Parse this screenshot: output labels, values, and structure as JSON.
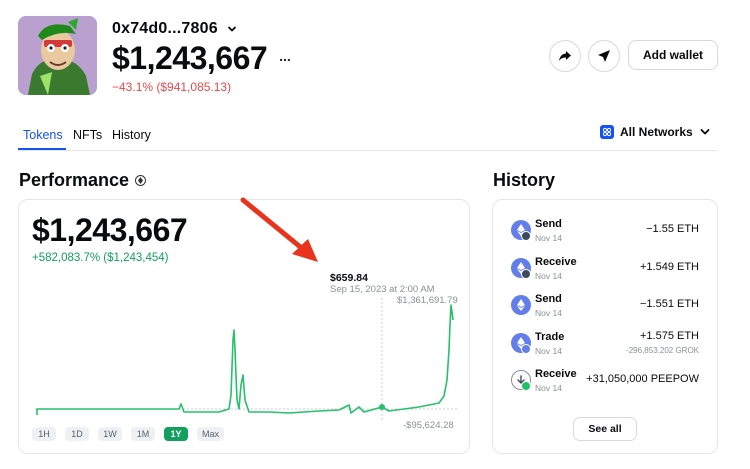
{
  "header": {
    "address": "0x74d0...7806",
    "balance": "$1,243,667",
    "more_label": "...",
    "change": "−43.1% ($941,085.13)",
    "add_wallet_label": "Add wallet"
  },
  "tabs": [
    {
      "label": "Tokens",
      "active": true
    },
    {
      "label": "NFTs",
      "active": false
    },
    {
      "label": "History",
      "active": false
    }
  ],
  "networks_label": "All Networks",
  "performance": {
    "title": "Performance",
    "value": "$1,243,667",
    "gain": "+582,083.7% ($1,243,454)",
    "hover_price": "$659.84",
    "hover_date": "Sep 15, 2023 at 2:00 AM",
    "max_label": "$1,361,691.79",
    "min_label": "-$95,624.28",
    "ranges": [
      "1H",
      "1D",
      "1W",
      "1M",
      "1Y",
      "Max"
    ],
    "active_range": "1Y"
  },
  "history": {
    "title": "History",
    "items": [
      {
        "type": "Send",
        "date": "Nov 14",
        "amount": "−1.55 ETH",
        "sub": ""
      },
      {
        "type": "Receive",
        "date": "Nov 14",
        "amount": "+1.549 ETH",
        "sub": ""
      },
      {
        "type": "Send",
        "date": "Nov 14",
        "amount": "−1.551 ETH",
        "sub": ""
      },
      {
        "type": "Trade",
        "date": "Nov 14",
        "amount": "+1.575 ETH",
        "sub": "-296,853.202 GROK"
      },
      {
        "type": "Receive",
        "date": "Nov 14",
        "amount": "+31,050,000 PEEPOW",
        "sub": ""
      }
    ],
    "see_all_label": "See all"
  },
  "colors": {
    "accent": "#1652f0",
    "positive": "#13a05f",
    "negative": "#e5484d",
    "annotation_arrow": "#e8341c"
  }
}
